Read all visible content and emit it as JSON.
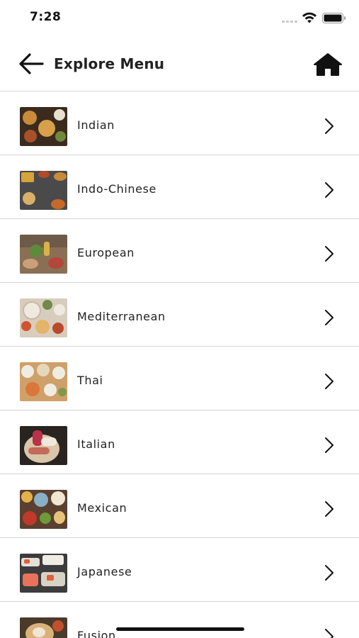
{
  "status_bar": {
    "time": "7:28"
  },
  "header": {
    "title": "Explore Menu",
    "back_icon": "arrow-left-icon",
    "home_icon": "home-icon"
  },
  "menu": {
    "items": [
      {
        "label": "Indian",
        "icon": "chevron-right-icon"
      },
      {
        "label": "Indo-Chinese",
        "icon": "chevron-right-icon"
      },
      {
        "label": "European",
        "icon": "chevron-right-icon"
      },
      {
        "label": "Mediterranean",
        "icon": "chevron-right-icon"
      },
      {
        "label": "Thai",
        "icon": "chevron-right-icon"
      },
      {
        "label": "Italian",
        "icon": "chevron-right-icon"
      },
      {
        "label": "Mexican",
        "icon": "chevron-right-icon"
      },
      {
        "label": "Japanese",
        "icon": "chevron-right-icon"
      },
      {
        "label": "Fusion",
        "icon": "chevron-right-icon"
      }
    ]
  },
  "colors": {
    "text": "#222222",
    "divider": "#d6d6d6",
    "background": "#ffffff"
  }
}
